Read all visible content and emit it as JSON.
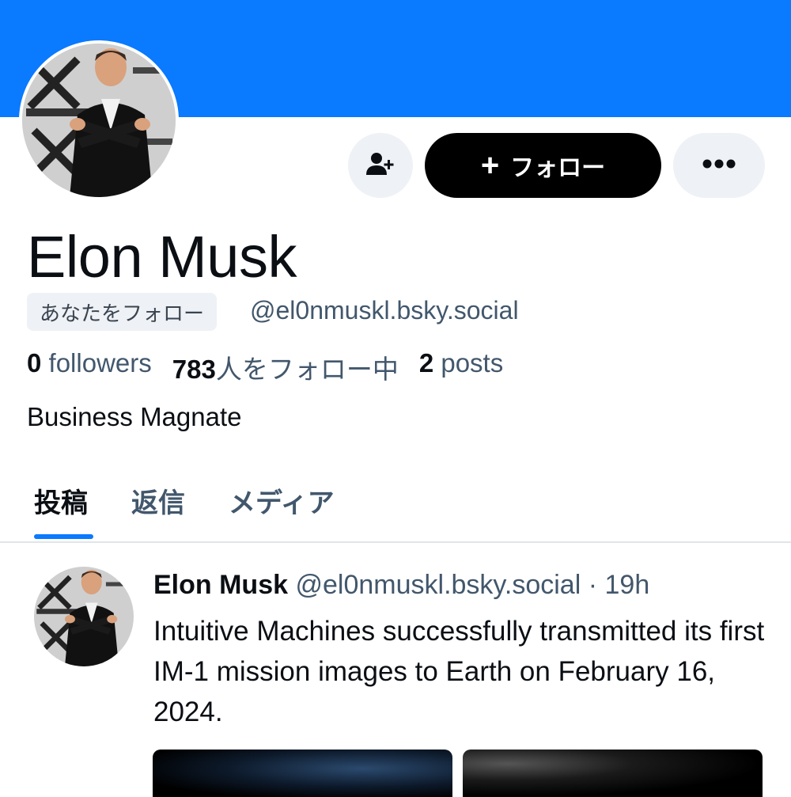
{
  "header": {
    "follow_label": "フォロー",
    "follow_plus": "+",
    "banner_color": "#0a7aff"
  },
  "profile": {
    "display_name": "Elon Musk",
    "follows_you_badge": "あなたをフォロー",
    "handle": "@el0nmuskl.bsky.social",
    "stats": {
      "followers_count": "0",
      "followers_label": " followers",
      "following_count": "783",
      "following_label": "人をフォロー中",
      "posts_count": "2",
      "posts_label": " posts"
    },
    "bio": "Business Magnate"
  },
  "tabs": [
    {
      "label": "投稿",
      "active": true
    },
    {
      "label": "返信",
      "active": false
    },
    {
      "label": "メディア",
      "active": false
    }
  ],
  "post": {
    "author_name": "Elon Musk",
    "author_handle": "@el0nmuskl.bsky.social",
    "separator": " · ",
    "time": "19h",
    "text": "Intuitive Machines successfully transmitted its first IM-1 mission images to Earth on February 16, 2024."
  },
  "icons": {
    "add_user": "person-add-icon",
    "more": "ellipsis-icon",
    "plus": "plus-icon"
  },
  "colors": {
    "accent": "#0a7aff",
    "button_dark": "#000000",
    "muted_text": "#42576c",
    "chip_bg": "#eef1f5"
  }
}
